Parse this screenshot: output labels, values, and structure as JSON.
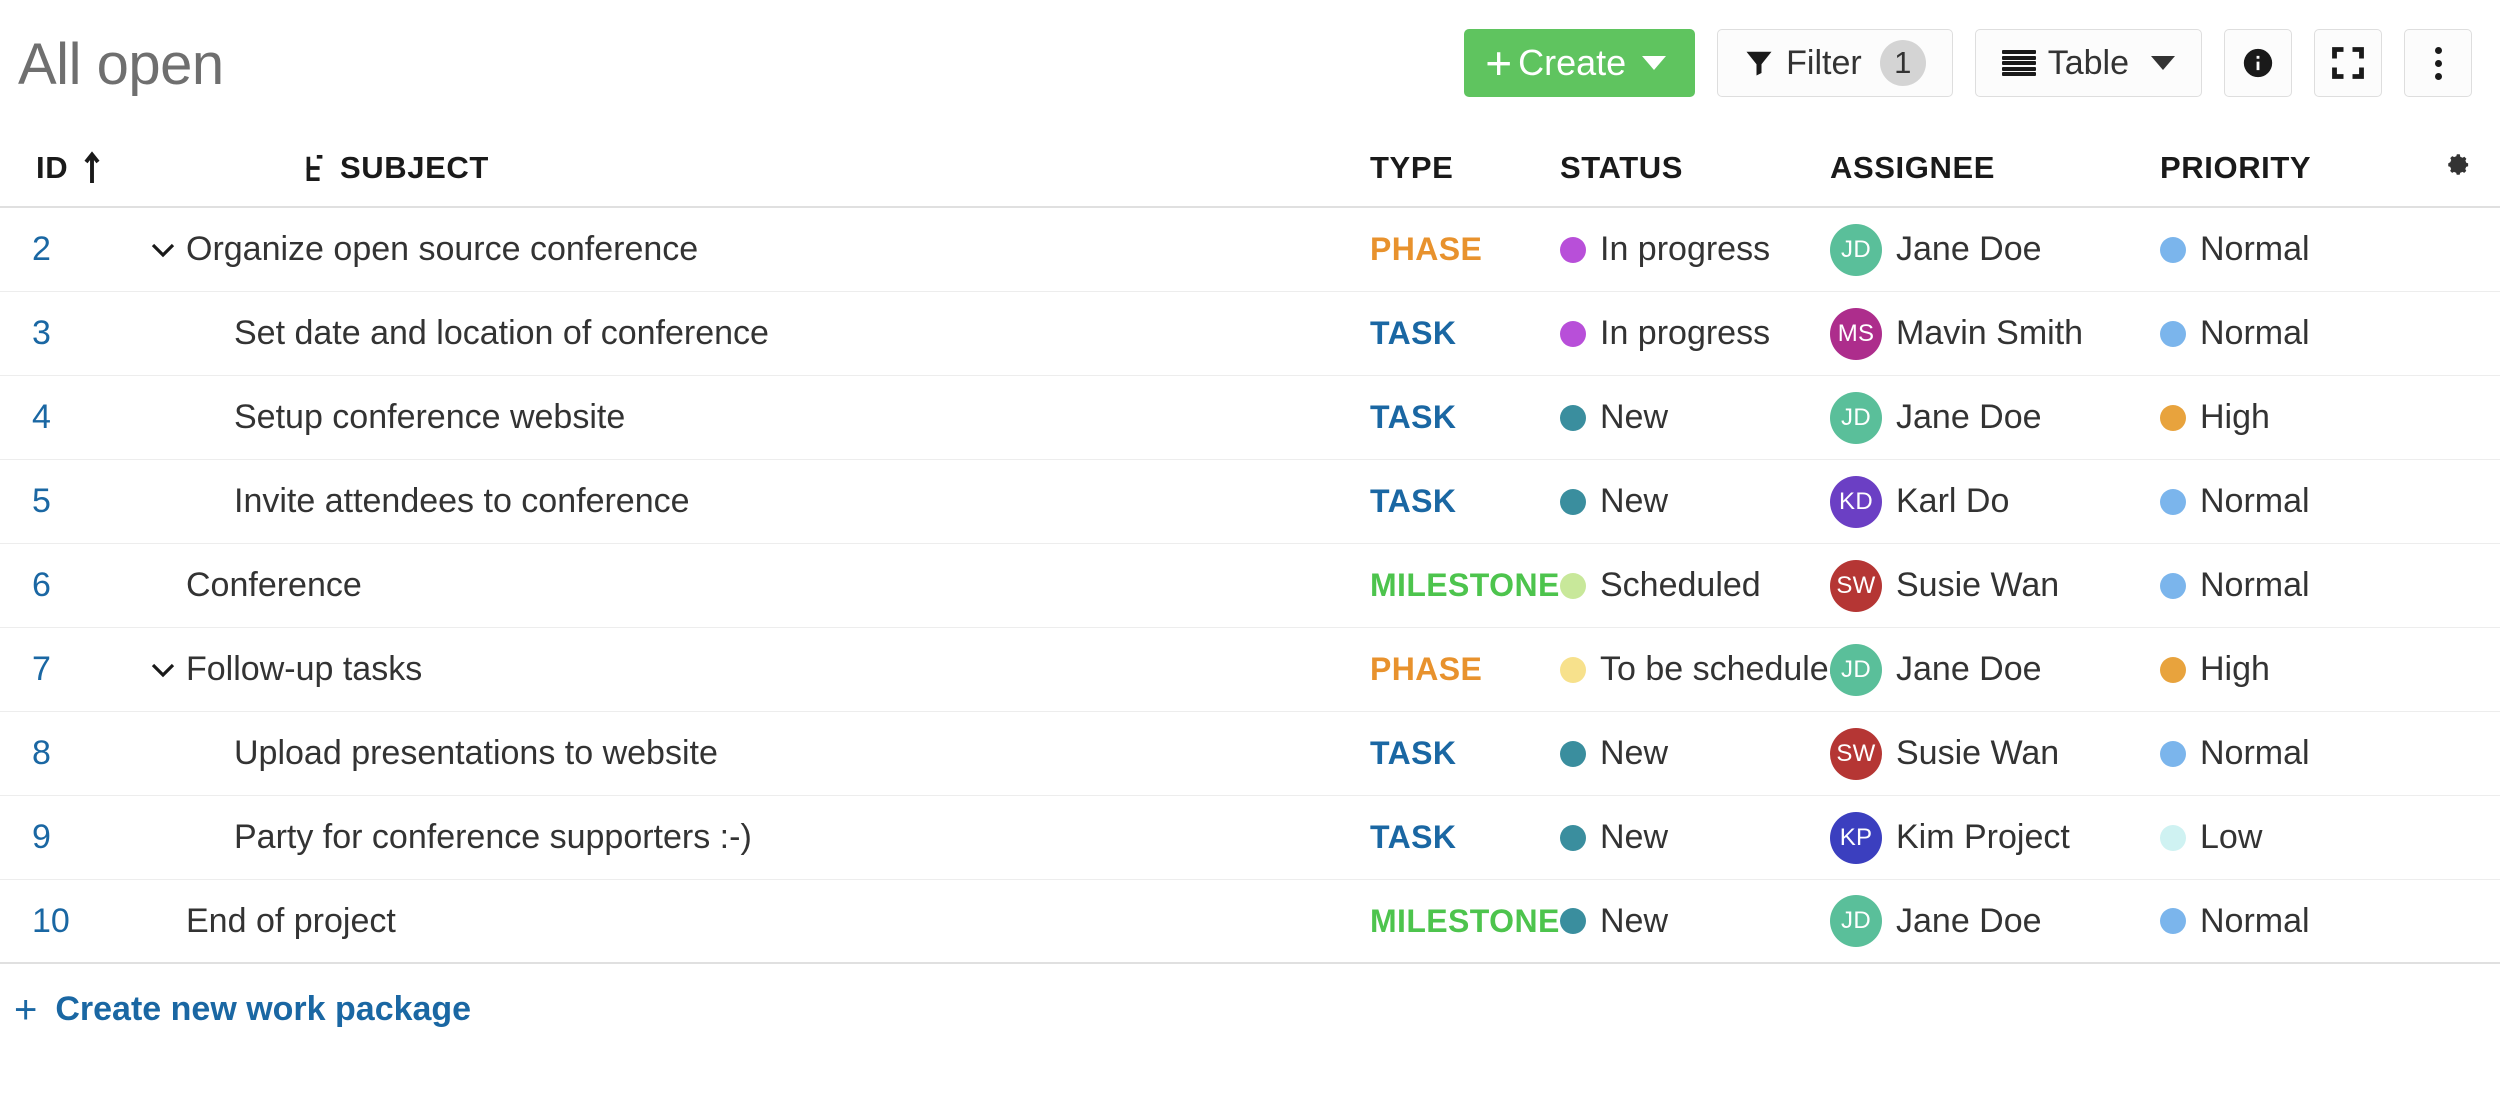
{
  "header": {
    "title": "All open"
  },
  "toolbar": {
    "create_label": "Create",
    "filter_label": "Filter",
    "filter_count": "1",
    "view_label": "Table",
    "info_icon": "info-icon",
    "fullscreen_icon": "fullscreen-icon",
    "more_icon": "more-vertical-icon"
  },
  "table": {
    "columns": {
      "id": "ID",
      "subject": "SUBJECT",
      "type": "TYPE",
      "status": "STATUS",
      "assignee": "ASSIGNEE",
      "priority": "PRIORITY",
      "settings_icon": "gear-icon"
    },
    "sort_icon": "sort-ascending-icon",
    "hierarchy_icon": "hierarchy-icon",
    "rows": [
      {
        "id": "2",
        "subject": "Organize open source conference",
        "indent": 0,
        "collapsible": true,
        "type": "PHASE",
        "type_color": "#E8922D",
        "status": "In progress",
        "status_color": "#B84FD9",
        "assignee": "Jane Doe",
        "initials": "JD",
        "avatar_color": "#5ABF9A",
        "priority": "Normal",
        "priority_color": "#7BB5EC"
      },
      {
        "id": "3",
        "subject": "Set date and location of conference",
        "indent": 1,
        "collapsible": false,
        "type": "TASK",
        "type_color": "#1A67A3",
        "status": "In progress",
        "status_color": "#B84FD9",
        "assignee": "Mavin Smith",
        "initials": "MS",
        "avatar_color": "#AD2D8C",
        "priority": "Normal",
        "priority_color": "#7BB5EC"
      },
      {
        "id": "4",
        "subject": "Setup conference website",
        "indent": 1,
        "collapsible": false,
        "type": "TASK",
        "type_color": "#1A67A3",
        "status": "New",
        "status_color": "#3A8E9E",
        "assignee": "Jane Doe",
        "initials": "JD",
        "avatar_color": "#5ABF9A",
        "priority": "High",
        "priority_color": "#E8A33D"
      },
      {
        "id": "5",
        "subject": "Invite attendees to conference",
        "indent": 1,
        "collapsible": false,
        "type": "TASK",
        "type_color": "#1A67A3",
        "status": "New",
        "status_color": "#3A8E9E",
        "assignee": "Karl Do",
        "initials": "KD",
        "avatar_color": "#6B3FC4",
        "priority": "Normal",
        "priority_color": "#7BB5EC"
      },
      {
        "id": "6",
        "subject": "Conference",
        "indent": 0,
        "collapsible": false,
        "type": "MILESTONE",
        "type_color": "#4DC44D",
        "status": "Scheduled",
        "status_color": "#C8E89A",
        "assignee": "Susie Wan",
        "initials": "SW",
        "avatar_color": "#B53634",
        "priority": "Normal",
        "priority_color": "#7BB5EC"
      },
      {
        "id": "7",
        "subject": "Follow-up tasks",
        "indent": 0,
        "collapsible": true,
        "type": "PHASE",
        "type_color": "#E8922D",
        "status": "To be scheduled",
        "status_color": "#F7E18C",
        "assignee": "Jane Doe",
        "initials": "JD",
        "avatar_color": "#5ABF9A",
        "priority": "High",
        "priority_color": "#E8A33D"
      },
      {
        "id": "8",
        "subject": "Upload presentations to website",
        "indent": 1,
        "collapsible": false,
        "type": "TASK",
        "type_color": "#1A67A3",
        "status": "New",
        "status_color": "#3A8E9E",
        "assignee": "Susie Wan",
        "initials": "SW",
        "avatar_color": "#B53634",
        "priority": "Normal",
        "priority_color": "#7BB5EC"
      },
      {
        "id": "9",
        "subject": "Party for conference supporters :-)",
        "indent": 1,
        "collapsible": false,
        "type": "TASK",
        "type_color": "#1A67A3",
        "status": "New",
        "status_color": "#3A8E9E",
        "assignee": "Kim Project",
        "initials": "KP",
        "avatar_color": "#3B3FBF",
        "priority": "Low",
        "priority_color": "#CFF2F2"
      },
      {
        "id": "10",
        "subject": "End of project",
        "indent": 0,
        "collapsible": false,
        "type": "MILESTONE",
        "type_color": "#4DC44D",
        "status": "New",
        "status_color": "#3A8E9E",
        "assignee": "Jane Doe",
        "initials": "JD",
        "avatar_color": "#5ABF9A",
        "priority": "Normal",
        "priority_color": "#7BB5EC"
      }
    ]
  },
  "footer": {
    "create_link": "Create new work package"
  }
}
